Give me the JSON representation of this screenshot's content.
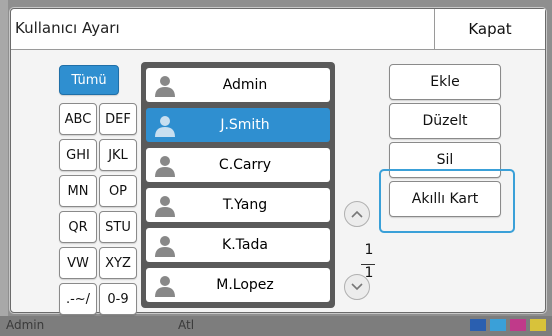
{
  "dialog": {
    "title": "Kullanıcı Ayarı",
    "close_label": "Kapat"
  },
  "filters": [
    {
      "label": "Tümü",
      "selected": true
    },
    {
      "label": "ABC"
    },
    {
      "label": "DEF"
    },
    {
      "label": "GHI"
    },
    {
      "label": "JKL"
    },
    {
      "label": "MN"
    },
    {
      "label": "OP"
    },
    {
      "label": "QR"
    },
    {
      "label": "STU"
    },
    {
      "label": "VW"
    },
    {
      "label": "XYZ"
    },
    {
      "label": ".-~/"
    },
    {
      "label": "0-9"
    }
  ],
  "users": [
    {
      "name": "Admin"
    },
    {
      "name": "J.Smith",
      "selected": true
    },
    {
      "name": "C.Carry"
    },
    {
      "name": "T.Yang"
    },
    {
      "name": "K.Tada"
    },
    {
      "name": "M.Lopez"
    }
  ],
  "actions": {
    "add": "Ekle",
    "edit": "Düzelt",
    "delete": "Sil",
    "smart_card": "Akıllı Kart"
  },
  "pager": {
    "current": "1",
    "total": "1"
  },
  "statusbar": {
    "user": "Admin",
    "mode": "Atl"
  },
  "colors": {
    "accent": "#2f8fd0",
    "highlight": "#3aa0d8"
  }
}
